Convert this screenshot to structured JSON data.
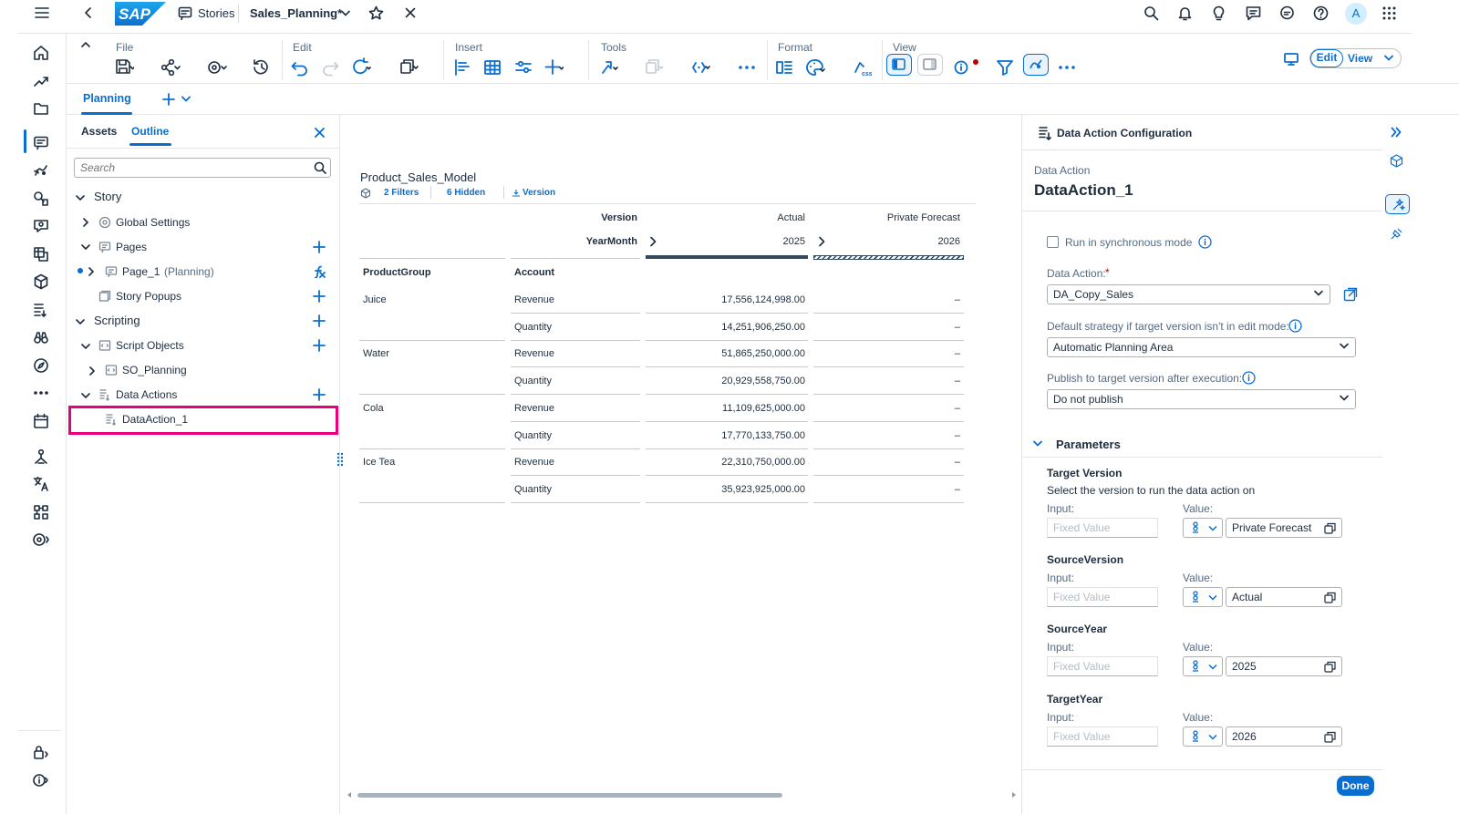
{
  "shell": {
    "stories_label": "Stories",
    "story_title": "Sales_Planning*",
    "avatar_initial": "A"
  },
  "toolbar": {
    "groups": {
      "file": "File",
      "edit": "Edit",
      "insert": "Insert",
      "tools": "Tools",
      "format": "Format",
      "view": "View"
    },
    "edit_mode": "Edit",
    "view_mode": "View"
  },
  "page_tabs": {
    "planning": "Planning"
  },
  "outline_panel": {
    "tabs": {
      "assets": "Assets",
      "outline": "Outline"
    },
    "search_placeholder": "Search",
    "tree": {
      "story": "Story",
      "global_settings": "Global Settings",
      "pages": "Pages",
      "page_1": "Page_1",
      "page_1_suffix": "(Planning)",
      "story_popups": "Story Popups",
      "scripting": "Scripting",
      "script_objects": "Script Objects",
      "so_planning": "SO_Planning",
      "data_actions": "Data Actions",
      "data_action_1": "DataAction_1"
    }
  },
  "table": {
    "title": "Product_Sales_Model",
    "filters": "2 Filters",
    "hidden": "6 Hidden",
    "version_link": "Version",
    "header": {
      "version": "Version",
      "yearmonth": "YearMonth",
      "actual": "Actual",
      "private_forecast": "Private Forecast",
      "year_2025": "2025",
      "year_2026": "2026",
      "product_group": "ProductGroup",
      "account": "Account"
    },
    "rows": [
      {
        "group": "Juice",
        "account": "Revenue",
        "actual": "17,556,124,998.00",
        "forecast": "–"
      },
      {
        "group": "",
        "account": "Quantity",
        "actual": "14,251,906,250.00",
        "forecast": "–"
      },
      {
        "group": "Water",
        "account": "Revenue",
        "actual": "51,865,250,000.00",
        "forecast": "–"
      },
      {
        "group": "",
        "account": "Quantity",
        "actual": "20,929,558,750.00",
        "forecast": "–"
      },
      {
        "group": "Cola",
        "account": "Revenue",
        "actual": "11,109,625,000.00",
        "forecast": "–"
      },
      {
        "group": "",
        "account": "Quantity",
        "actual": "17,770,133,750.00",
        "forecast": "–"
      },
      {
        "group": "Ice Tea",
        "account": "Revenue",
        "actual": "22,310,750,000.00",
        "forecast": "–"
      },
      {
        "group": "",
        "account": "Quantity",
        "actual": "35,923,925,000.00",
        "forecast": "–"
      }
    ]
  },
  "config_panel": {
    "header": "Data Action Configuration",
    "subtitle_label": "Data Action",
    "name": "DataAction_1",
    "sync_mode_label": "Run in synchronous mode",
    "data_action_label": "Data Action:",
    "required_mark": "*",
    "data_action_value": "DA_Copy_Sales",
    "default_strategy_label": "Default strategy if target version isn't in edit mode:",
    "default_strategy_value": "Automatic Planning Area",
    "publish_label": "Publish to target version after execution:",
    "publish_value": "Do not publish",
    "parameters_title": "Parameters",
    "input_label": "Input:",
    "value_label": "Value:",
    "fixed_placeholder": "Fixed Value",
    "parameters": [
      {
        "name": "Target Version",
        "desc": "Select the version to run the data action on",
        "value": "Private Forecast"
      },
      {
        "name": "SourceVersion",
        "desc": "",
        "value": "Actual"
      },
      {
        "name": "SourceYear",
        "desc": "",
        "value": "2025"
      },
      {
        "name": "TargetYear",
        "desc": "",
        "value": "2026"
      }
    ],
    "done_label": "Done"
  },
  "colors": {
    "accent": "#0a6ed1",
    "highlight": "#e6007e",
    "sap_blue": "#0a6ed1"
  }
}
